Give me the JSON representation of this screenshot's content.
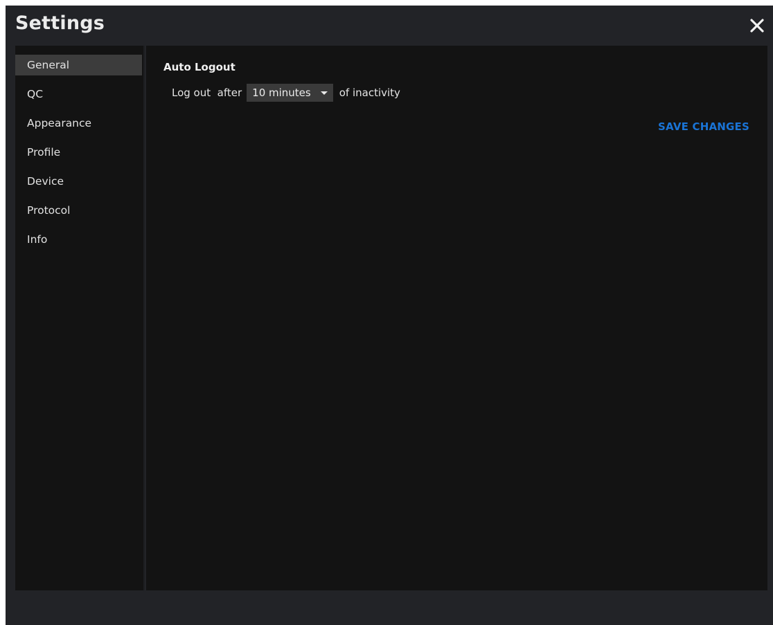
{
  "dialog": {
    "title": "Settings"
  },
  "sidebar": {
    "items": [
      {
        "label": "General"
      },
      {
        "label": "QC"
      },
      {
        "label": "Appearance"
      },
      {
        "label": "Profile"
      },
      {
        "label": "Device"
      },
      {
        "label": "Protocol"
      },
      {
        "label": "Info"
      }
    ],
    "active": "General"
  },
  "general": {
    "heading": "Auto Logout",
    "prefix": "Log out  after",
    "timeout_value": "10 minutes",
    "suffix": "of inactivity",
    "save_label": "SAVE CHANGES"
  },
  "colors": {
    "accent": "#1a74d6",
    "window_bg": "#222327",
    "panel_bg": "#131313",
    "active_item_bg": "#3c3c3c"
  },
  "icons": {
    "close": "close-icon",
    "dropdown": "chevron-down-icon"
  }
}
